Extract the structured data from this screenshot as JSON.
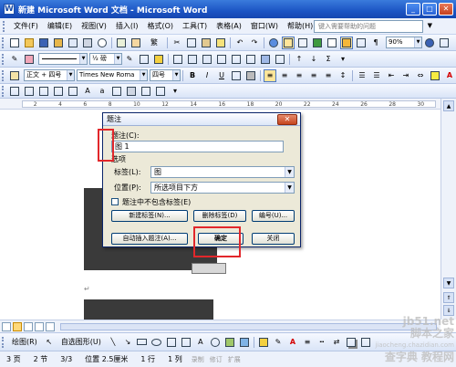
{
  "window": {
    "title": "新建 Microsoft Word 文档 - Microsoft Word",
    "app_icon": "W",
    "buttons": {
      "minimize": "_",
      "maximize": "□",
      "close": "✕"
    }
  },
  "menubar": {
    "items": [
      "文件(F)",
      "编辑(E)",
      "视图(V)",
      "插入(I)",
      "格式(O)",
      "工具(T)",
      "表格(A)",
      "窗口(W)",
      "帮助(H)"
    ],
    "help_placeholder": "键入需要帮助的问题",
    "help_arrow": "▼"
  },
  "toolbar1": {
    "zoom": "90%",
    "font_glyph": "繁"
  },
  "toolbar2": {
    "line_spacing": "½ 磅"
  },
  "format_bar": {
    "style": "正文 + 四号",
    "font": "Times New Roma",
    "size": "四号",
    "bold": "B",
    "italic": "I",
    "underline": "U",
    "font_color_glyph": "A"
  },
  "ruler": {
    "marks": [
      "2",
      "4",
      "6",
      "8",
      "10",
      "12",
      "14",
      "16",
      "18",
      "20",
      "22",
      "24",
      "26",
      "28",
      "30"
    ]
  },
  "dialog": {
    "title": "题注",
    "caption_label": "题注(C):",
    "caption_value": "图 1",
    "options_label": "选项",
    "label_label": "标签(L):",
    "label_value": "图",
    "position_label": "位置(P):",
    "position_value": "所选项目下方",
    "exclude_label": "题注中不包含标签(E)",
    "exclude_checked": false,
    "buttons": {
      "new_label": "新建标签(N)...",
      "delete_label": "删除标签(D)",
      "numbering": "编号(U)...",
      "auto_caption": "自动插入题注(A)...",
      "ok": "确定",
      "close": "关闭"
    },
    "close_glyph": "✕"
  },
  "document": {
    "paragraph_mark": "↵"
  },
  "drawbar": {
    "draw_label": "绘图(R)",
    "autoshapes_label": "自选图形(U)"
  },
  "statusbar": {
    "page": "3 页",
    "section": "2 节",
    "pages": "3/3",
    "position": "位置 2.5厘米",
    "line": "1 行",
    "column": "1 列",
    "flags": [
      "录制",
      "修订",
      "扩展"
    ]
  },
  "watermark": {
    "line1": "jb51.net",
    "line2": "脚本之家",
    "line3": "jiaocheng.chazidian.com",
    "line4": "查字典 教程网"
  },
  "colors": {
    "titlebar": "#1c55c4",
    "highlight_red": "#e2272b",
    "dialog_bg": "#ece9d8"
  }
}
